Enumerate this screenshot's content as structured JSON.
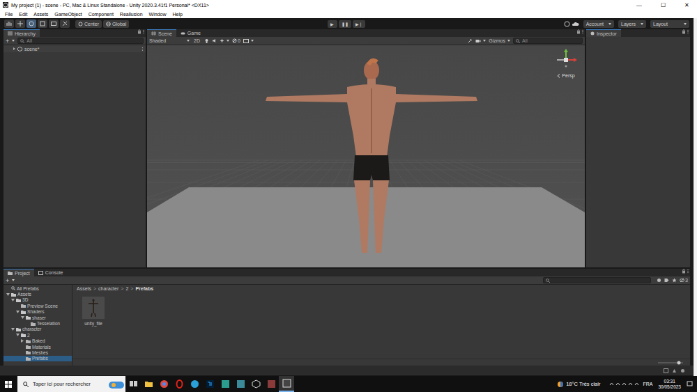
{
  "window": {
    "title": "My project (1) - scene - PC, Mac & Linux Standalone - Unity 2020.3.41f1 Personal* <DX11>",
    "controls": [
      "—",
      "☐",
      "✕"
    ]
  },
  "menu": [
    "File",
    "Edit",
    "Assets",
    "GameObject",
    "Component",
    "Reallusion",
    "Window",
    "Help"
  ],
  "toolbar": {
    "tools": [
      {
        "selected": false
      },
      {
        "selected": false
      },
      {
        "selected": true
      },
      {
        "selected": false
      },
      {
        "selected": false
      },
      {
        "selected": false
      }
    ],
    "pivot": "Center",
    "space": "Global",
    "play": [
      "▶",
      "❚❚",
      "▶❘"
    ],
    "right": [
      "Account",
      "Layers",
      "Layout"
    ]
  },
  "hierarchy": {
    "title": "Hierarchy",
    "add": "+",
    "search": {
      "placeholder": "All"
    },
    "items": [
      {
        "label": "scene*",
        "expanded": false
      }
    ]
  },
  "scene": {
    "tabs": [
      {
        "label": "Scene",
        "selected": true
      },
      {
        "label": "Game",
        "selected": false
      }
    ],
    "draw_mode": "Shaded",
    "mode_2d": "2D",
    "hidden_count": "0",
    "gizmos": "Gizmos",
    "search": {
      "placeholder": "All"
    },
    "projection": "Persp"
  },
  "inspector": {
    "title": "Inspector"
  },
  "project": {
    "tabs": [
      {
        "label": "Project",
        "selected": true
      },
      {
        "label": "Console",
        "selected": false
      }
    ],
    "add": "+",
    "hidden_count": "3",
    "tree": [
      {
        "label": "All Prefabs",
        "depth": 0,
        "kind": "search",
        "expanded": false,
        "selected": false
      },
      {
        "label": "Assets",
        "depth": 0,
        "kind": "folder",
        "expanded": true,
        "selected": false
      },
      {
        "label": "3D",
        "depth": 1,
        "kind": "folder",
        "expanded": true,
        "selected": false
      },
      {
        "label": "Preview Scene",
        "depth": 2,
        "kind": "leaf",
        "expanded": false,
        "selected": false
      },
      {
        "label": "Shaders",
        "depth": 2,
        "kind": "folder",
        "expanded": true,
        "selected": false
      },
      {
        "label": "shaser",
        "depth": 3,
        "kind": "folder",
        "expanded": true,
        "selected": false
      },
      {
        "label": "Tesselation",
        "depth": 4,
        "kind": "leaf",
        "expanded": false,
        "selected": false
      },
      {
        "label": "character",
        "depth": 1,
        "kind": "folder",
        "expanded": true,
        "selected": false
      },
      {
        "label": "2",
        "depth": 2,
        "kind": "folder",
        "expanded": true,
        "selected": false
      },
      {
        "label": "Baked",
        "depth": 3,
        "kind": "folder",
        "expanded": false,
        "selected": false
      },
      {
        "label": "Materials",
        "depth": 3,
        "kind": "leaf",
        "expanded": false,
        "selected": false
      },
      {
        "label": "Meshes",
        "depth": 3,
        "kind": "leaf",
        "expanded": false,
        "selected": false
      },
      {
        "label": "Prefabs",
        "depth": 3,
        "kind": "leaf",
        "expanded": false,
        "selected": true
      }
    ],
    "breadcrumb": [
      "Assets",
      "character",
      "2",
      "Prefabs"
    ],
    "separator": ">",
    "assets": [
      {
        "label": "unity_file"
      }
    ]
  },
  "taskbar": {
    "search": {
      "placeholder": "Taper ici pour rechercher"
    },
    "weather": "18°C Très clair",
    "language": "FRA",
    "time": "03:31",
    "date": "30/05/2023"
  }
}
